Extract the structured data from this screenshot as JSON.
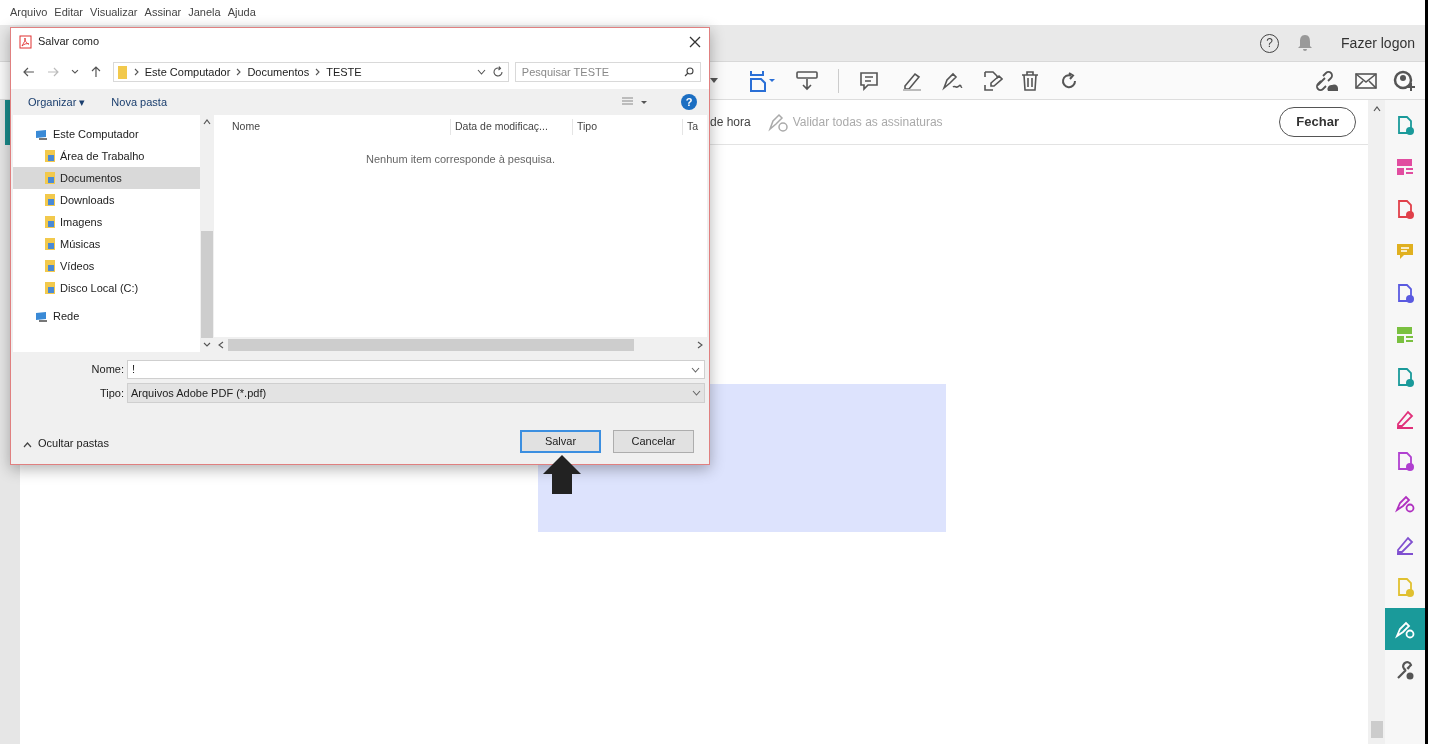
{
  "menu_bar": [
    "Arquivo",
    "Editar",
    "Visualizar",
    "Assinar",
    "Janela",
    "Ajuda"
  ],
  "top_bar": {
    "help": "?",
    "sign_in": "Fazer logon"
  },
  "toolbar": {
    "partial_label": "de hora",
    "validate_label": "Validar todas as assinaturas",
    "close_button": "Fechar"
  },
  "tools_panel": [
    {
      "kind": "doc",
      "color": "#1a9a9a",
      "selected": false
    },
    {
      "kind": "layout",
      "color": "#e14da0",
      "selected": false
    },
    {
      "kind": "doc",
      "color": "#e0404a",
      "selected": false
    },
    {
      "kind": "comment",
      "color": "#e0b020",
      "selected": false
    },
    {
      "kind": "doc",
      "color": "#5a5ae0",
      "selected": false
    },
    {
      "kind": "layout",
      "color": "#7ac040",
      "selected": false
    },
    {
      "kind": "doc",
      "color": "#1a9a9a",
      "selected": false
    },
    {
      "kind": "pen",
      "color": "#e0307a",
      "selected": false
    },
    {
      "kind": "doc",
      "color": "#b040d0",
      "selected": false
    },
    {
      "kind": "signature",
      "color": "#b030c0",
      "selected": false
    },
    {
      "kind": "pen",
      "color": "#8050d0",
      "selected": false
    },
    {
      "kind": "doc",
      "color": "#e0c030",
      "selected": false
    },
    {
      "kind": "signature",
      "color": "#1a9a9a",
      "selected": true
    },
    {
      "kind": "wrench",
      "color": "#555555",
      "selected": false
    }
  ],
  "dialog": {
    "title": "Salvar como",
    "breadcrumb": [
      "Este Computador",
      "Documentos",
      "TESTE"
    ],
    "search": {
      "placeholder": "Pesquisar TESTE"
    },
    "commands": [
      "Organizar ▾",
      "Nova pasta"
    ],
    "help": "?",
    "nav_tree": [
      {
        "label": "Este Computador",
        "selected": false,
        "children": [
          {
            "label": "Área de Trabalho",
            "selected": false
          },
          {
            "label": "Documentos",
            "selected": true
          },
          {
            "label": "Downloads",
            "selected": false
          },
          {
            "label": "Imagens",
            "selected": false
          },
          {
            "label": "Músicas",
            "selected": false
          },
          {
            "label": "Vídeos",
            "selected": false
          },
          {
            "label": "Disco Local (C:)",
            "selected": false
          }
        ]
      },
      {
        "label": "Rede",
        "selected": false
      }
    ],
    "columns": [
      "Nome",
      "Data de modificaç...",
      "Tipo",
      "Ta"
    ],
    "empty_message": "Nenhum item corresponde à pesquisa.",
    "name_label": "Nome:",
    "name_value": "!",
    "type_label": "Tipo:",
    "type_value": "Arquivos Adobe PDF (*.pdf)",
    "hide_folders": "Ocultar pastas",
    "buttons": [
      "Salvar",
      "Cancelar"
    ]
  }
}
